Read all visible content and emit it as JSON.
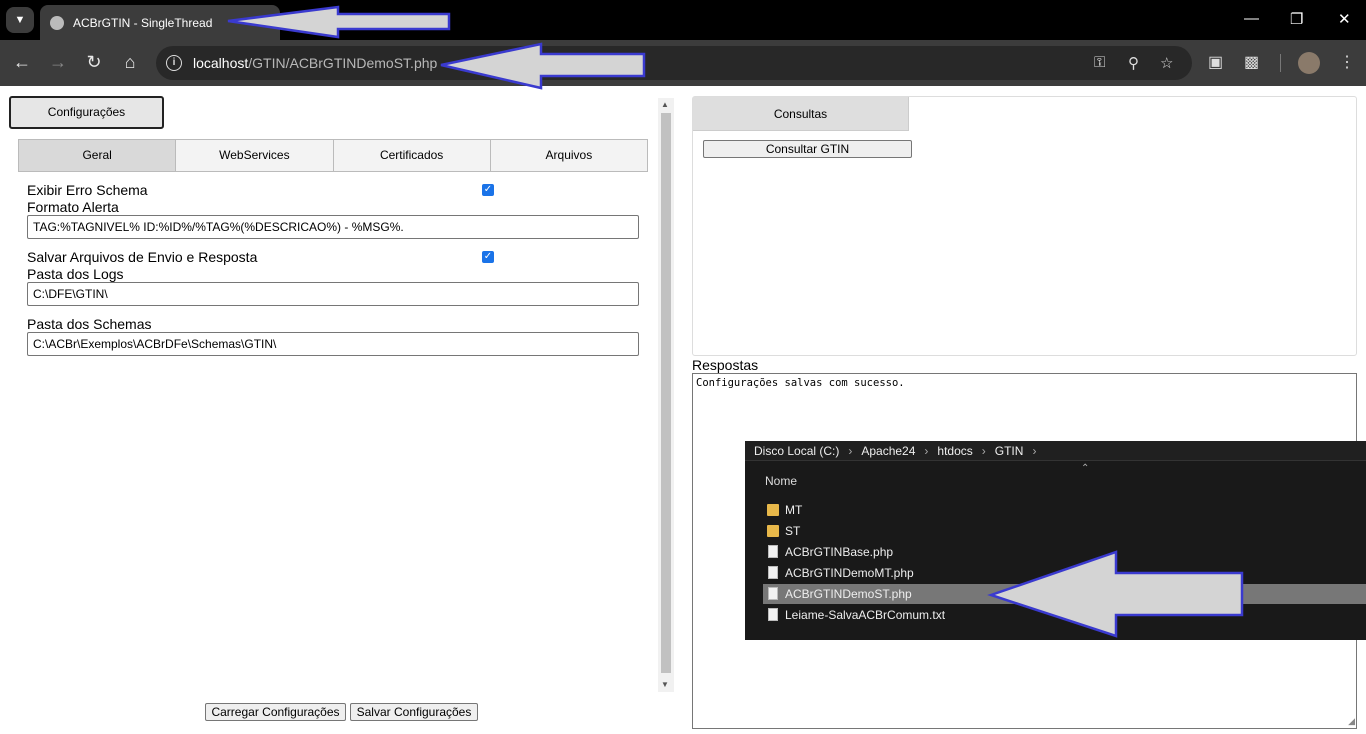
{
  "browser": {
    "tab_title": "ACBrGTIN - SingleThread",
    "url_host": "localhost",
    "url_path": "/GTIN/ACBrGTINDemoST.php"
  },
  "left": {
    "config_button": "Configurações",
    "tabs": [
      {
        "label": "Geral",
        "active": true
      },
      {
        "label": "WebServices",
        "active": false
      },
      {
        "label": "Certificados",
        "active": false
      },
      {
        "label": "Arquivos",
        "active": false
      }
    ],
    "exibir_erro_label": "Exibir Erro Schema",
    "exibir_erro_checked": true,
    "formato_alerta_label": "Formato Alerta",
    "formato_alerta_value": "TAG:%TAGNIVEL% ID:%ID%/%TAG%(%DESCRICAO%) - %MSG%.",
    "salvar_arquivos_label": "Salvar Arquivos de Envio e Resposta",
    "salvar_arquivos_checked": true,
    "pasta_logs_label": "Pasta dos Logs",
    "pasta_logs_value": "C:\\DFE\\GTIN\\",
    "pasta_schemas_label": "Pasta dos Schemas",
    "pasta_schemas_value": "C:\\ACBr\\Exemplos\\ACBrDFe\\Schemas\\GTIN\\",
    "carregar_button": "Carregar Configurações",
    "salvar_button": "Salvar Configurações"
  },
  "right": {
    "consultas_tab": "Consultas",
    "consultar_button": "Consultar GTIN",
    "respostas_label": "Respostas",
    "respostas_text": "Configurações salvas com sucesso."
  },
  "explorer": {
    "breadcrumb": [
      "Disco Local (C:)",
      "Apache24",
      "htdocs",
      "GTIN"
    ],
    "column_header": "Nome",
    "items": [
      {
        "name": "MT",
        "type": "folder",
        "selected": false
      },
      {
        "name": "ST",
        "type": "folder",
        "selected": false
      },
      {
        "name": "ACBrGTINBase.php",
        "type": "file",
        "selected": false
      },
      {
        "name": "ACBrGTINDemoMT.php",
        "type": "file",
        "selected": false
      },
      {
        "name": "ACBrGTINDemoST.php",
        "type": "file",
        "selected": true
      },
      {
        "name": "Leiame-SalvaACBrComum.txt",
        "type": "file",
        "selected": false
      }
    ]
  },
  "colors": {
    "annotation_arrow_stroke": "#3a3acf",
    "annotation_arrow_fill": "#d4d4d4"
  }
}
